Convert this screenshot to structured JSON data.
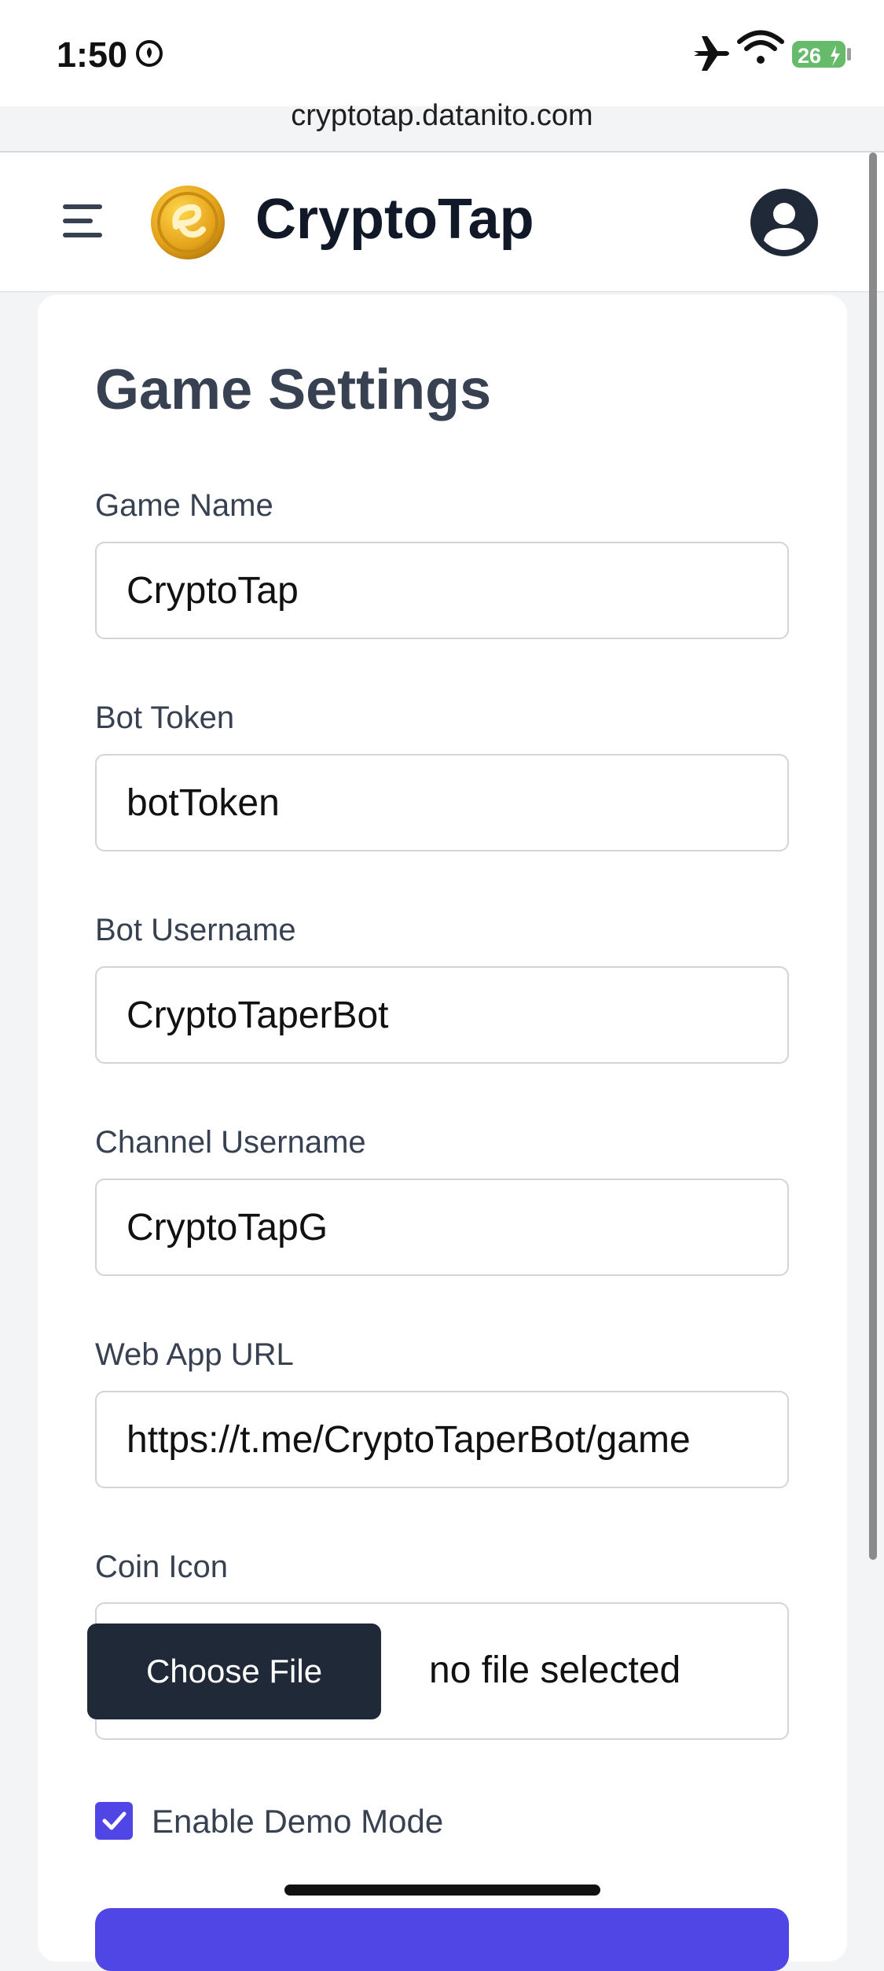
{
  "status_bar": {
    "time": "1:50",
    "battery": "26",
    "icons": [
      "focus-icon",
      "airplane-icon",
      "wifi-icon",
      "battery-icon"
    ]
  },
  "browser": {
    "url": "cryptotap.datanito.com"
  },
  "header": {
    "title": "CryptoTap",
    "icons": [
      "menu-icon",
      "coin-logo",
      "user-avatar-icon"
    ]
  },
  "settings": {
    "title": "Game Settings",
    "fields": [
      {
        "label": "Game Name",
        "value": "CryptoTap"
      },
      {
        "label": "Bot Token",
        "value": "botToken"
      },
      {
        "label": "Bot Username",
        "value": "CryptoTaperBot"
      },
      {
        "label": "Channel Username",
        "value": "CryptoTapG"
      },
      {
        "label": "Web App URL",
        "value": "https://t.me/CryptoTaperBot/game"
      }
    ],
    "coin_icon": {
      "label": "Coin Icon",
      "button": "Choose File",
      "status": "no file selected"
    },
    "demo_mode": {
      "label": "Enable Demo Mode",
      "checked": true
    }
  },
  "colors": {
    "accent": "#4f46e5",
    "dark_button": "#1f2937",
    "heading": "#374151",
    "page_bg": "#f3f4f6"
  }
}
